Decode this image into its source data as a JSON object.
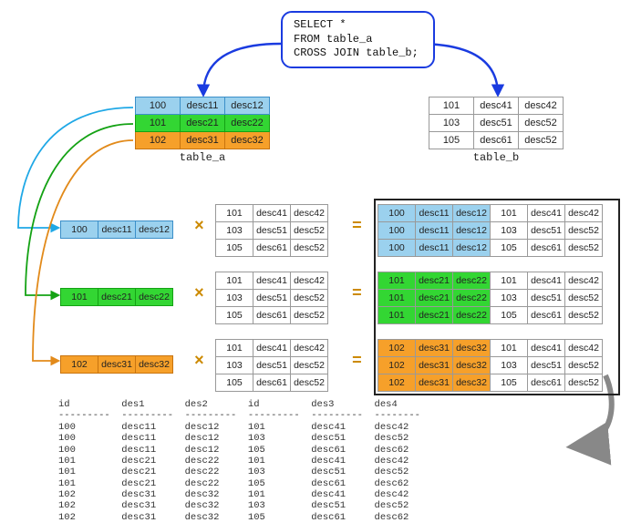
{
  "sql": {
    "line1": "SELECT *",
    "line2": "FROM table_a",
    "line3": "CROSS JOIN table_b;"
  },
  "tnames": {
    "a": "table_a",
    "b": "table_b"
  },
  "table_a": [
    [
      "100",
      "desc11",
      "desc12"
    ],
    [
      "101",
      "desc21",
      "desc22"
    ],
    [
      "102",
      "desc31",
      "desc32"
    ]
  ],
  "table_b": [
    [
      "101",
      "desc41",
      "desc42"
    ],
    [
      "103",
      "desc51",
      "desc52"
    ],
    [
      "105",
      "desc61",
      "desc52"
    ]
  ],
  "single_rows": {
    "r0": [
      "100",
      "desc11",
      "desc12"
    ],
    "r1": [
      "101",
      "desc21",
      "desc22"
    ],
    "r2": [
      "102",
      "desc31",
      "desc32"
    ]
  },
  "ops": {
    "times": "×",
    "equals": "="
  },
  "cross_b": [
    [
      "101",
      "desc41",
      "desc42"
    ],
    [
      "103",
      "desc51",
      "desc52"
    ],
    [
      "105",
      "desc61",
      "desc52"
    ]
  ],
  "result_rows": {
    "g0": [
      [
        "100",
        "desc11",
        "desc12",
        "101",
        "desc41",
        "desc42"
      ],
      [
        "100",
        "desc11",
        "desc12",
        "103",
        "desc51",
        "desc52"
      ],
      [
        "100",
        "desc11",
        "desc12",
        "105",
        "desc61",
        "desc52"
      ]
    ],
    "g1": [
      [
        "101",
        "desc21",
        "desc22",
        "101",
        "desc41",
        "desc42"
      ],
      [
        "101",
        "desc21",
        "desc22",
        "103",
        "desc51",
        "desc52"
      ],
      [
        "101",
        "desc21",
        "desc22",
        "105",
        "desc61",
        "desc52"
      ]
    ],
    "g2": [
      [
        "102",
        "desc31",
        "desc32",
        "101",
        "desc41",
        "desc42"
      ],
      [
        "102",
        "desc31",
        "desc32",
        "103",
        "desc51",
        "desc52"
      ],
      [
        "102",
        "desc31",
        "desc32",
        "105",
        "desc61",
        "desc52"
      ]
    ]
  },
  "final_table": {
    "headers": [
      "id",
      "des1",
      "des2",
      "id",
      "des3",
      "des4"
    ],
    "divider": "---------",
    "rows": [
      [
        "100",
        "desc11",
        "desc12",
        "101",
        "desc41",
        "desc42"
      ],
      [
        "100",
        "desc11",
        "desc12",
        "103",
        "desc51",
        "desc52"
      ],
      [
        "100",
        "desc11",
        "desc12",
        "105",
        "desc61",
        "desc62"
      ],
      [
        "101",
        "desc21",
        "desc22",
        "101",
        "desc41",
        "desc42"
      ],
      [
        "101",
        "desc21",
        "desc22",
        "103",
        "desc51",
        "desc52"
      ],
      [
        "101",
        "desc21",
        "desc22",
        "105",
        "desc61",
        "desc62"
      ],
      [
        "102",
        "desc31",
        "desc32",
        "101",
        "desc41",
        "desc42"
      ],
      [
        "102",
        "desc31",
        "desc32",
        "103",
        "desc51",
        "desc52"
      ],
      [
        "102",
        "desc31",
        "desc32",
        "105",
        "desc61",
        "desc62"
      ]
    ]
  }
}
